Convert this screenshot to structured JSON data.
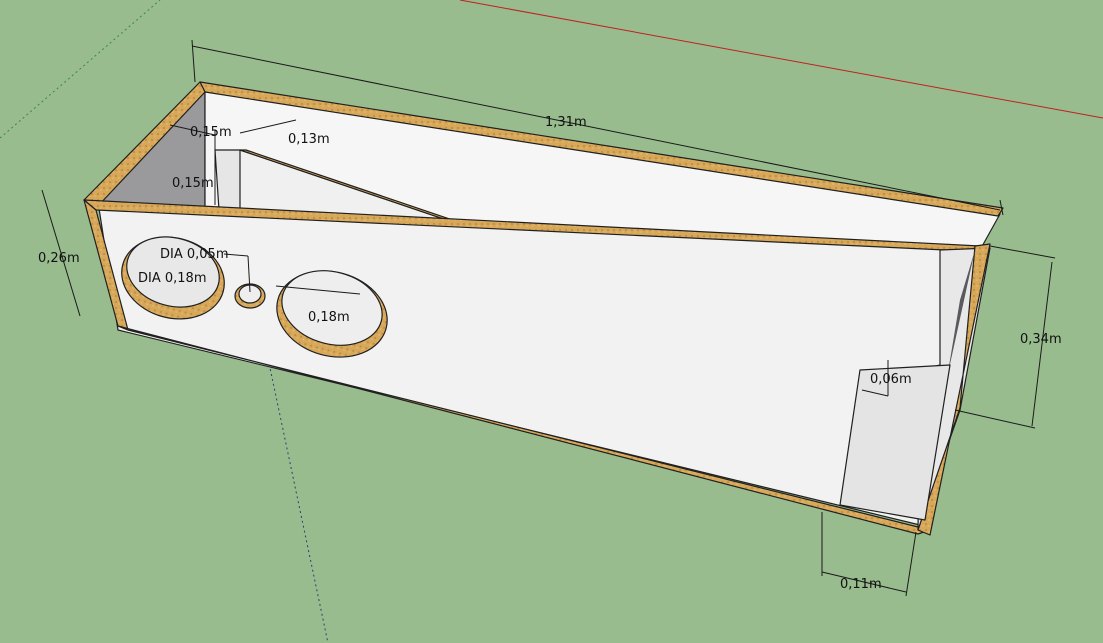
{
  "colors": {
    "ground": "#98bc8e",
    "panel_face": "#f2f2f2",
    "panel_shadow": "#9a9a9c",
    "wood_edge": "#d8a85a",
    "edge_line": "#202020",
    "axis_red": "#c02020",
    "axis_green": "#3a8a3a"
  },
  "dimensions": {
    "length": "1,31m",
    "height_back": "0,34m",
    "height_front": "0,26m",
    "depth_bottom": "0,11m",
    "slot_width": "0,06m",
    "top_inner_a": "0,15m",
    "side_inner": "0,15m",
    "throat": "0,13m",
    "port_diameter": "DIA 0,05m",
    "driver_diameter": "DIA 0,18m",
    "driver_cutout": "0,18m"
  }
}
